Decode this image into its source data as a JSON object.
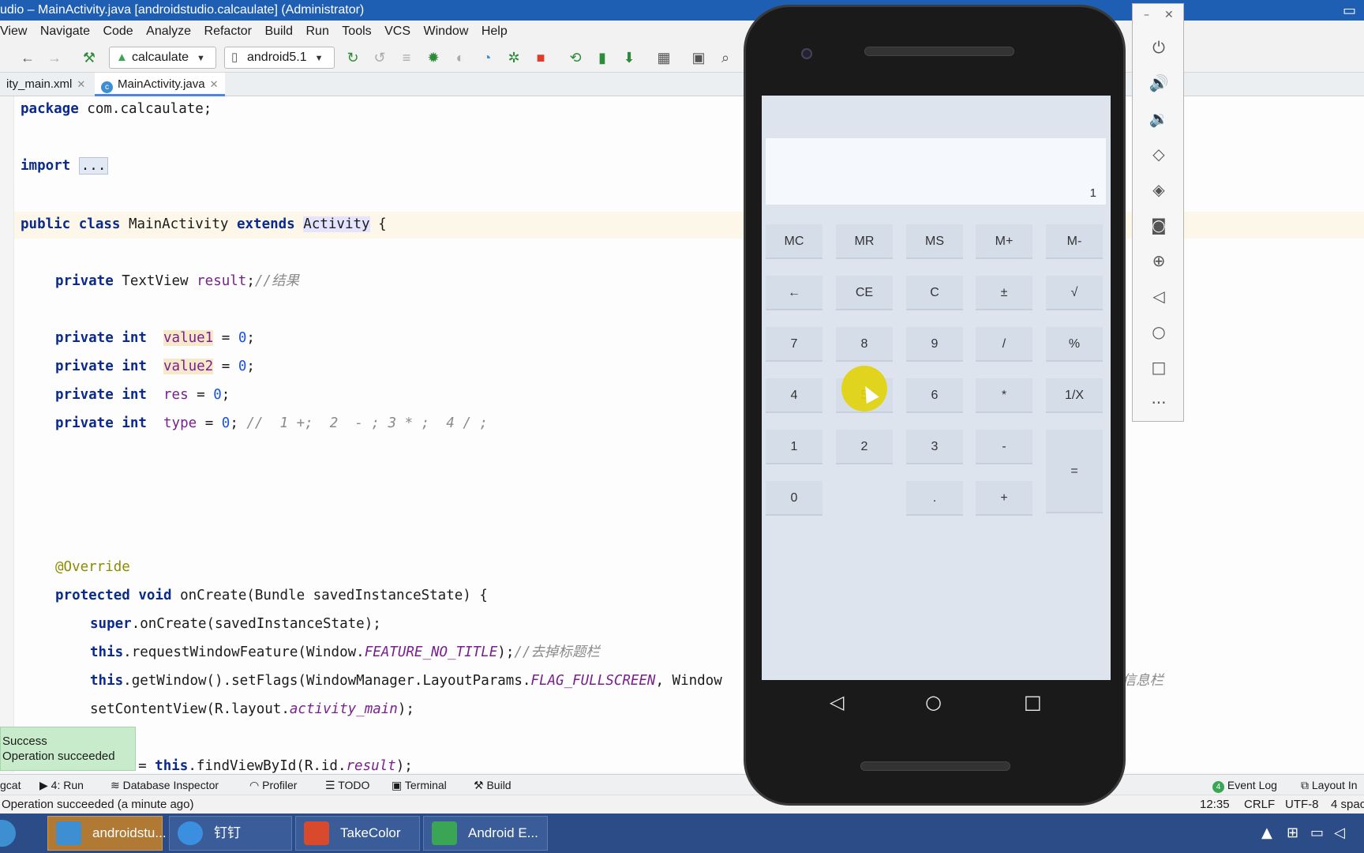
{
  "window": {
    "title": "udio – MainActivity.java [androidstudio.calcaulate] (Administrator)"
  },
  "menu": [
    "View",
    "Navigate",
    "Code",
    "Analyze",
    "Refactor",
    "Build",
    "Run",
    "Tools",
    "VCS",
    "Window",
    "Help"
  ],
  "toolbar": {
    "run_config": "calcaulate",
    "device": "android5.1"
  },
  "tabs": [
    {
      "label": "ity_main.xml"
    },
    {
      "label": "MainActivity.java"
    }
  ],
  "code": {
    "package_kw": "package",
    "package_name": " com.calcaulate;",
    "import_kw": "import",
    "import_fold": "...",
    "l3_public": "public",
    "l3_class": "class",
    "l3_name": " MainActivity ",
    "l3_extends": "extends",
    "l3_activity": "Activity",
    "l3_brace": " {",
    "l5_private": "private",
    "l5_type": " TextView ",
    "l5_field": "result",
    "l5_semi": ";",
    "l5_comment": "//结果",
    "l7_private": "private",
    "l7_int": "int",
    "l7_field": "value1",
    "l7_rest": " = ",
    "l7_num": "0",
    "l7_semi": ";",
    "l8_private": "private",
    "l8_int": "int",
    "l8_field": "value2",
    "l8_rest": " = ",
    "l8_num": "0",
    "l8_semi": ";",
    "l9_private": "private",
    "l9_int": "int",
    "l9_field": "res",
    "l9_rest": " = ",
    "l9_num": "0",
    "l9_semi": ";",
    "l10_private": "private",
    "l10_int": "int",
    "l10_field": "type",
    "l10_rest": " = ",
    "l10_num": "0",
    "l10_semi": ";",
    "l10_comment": " //  1 +;  2  - ; 3 * ;  4 / ;",
    "override": "@Override",
    "oc_protected": "protected",
    "oc_void": "void",
    "oc_sig": " onCreate(Bundle savedInstanceState) {",
    "sup_kw": "super",
    "sup_rest": ".onCreate(savedInstanceState);",
    "rw_this": "this",
    "rw_mid": ".requestWindowFeature(Window.",
    "rw_const": "FEATURE_NO_TITLE",
    "rw_end": ");",
    "rw_comment": "//去掉标题栏",
    "gw_this": "this",
    "gw_mid": ".getWindow().setFlags(WindowManager.LayoutParams.",
    "gw_const": "FLAG_FULLSCREEN",
    "gw_end": ", Window",
    "gw_tail_comment": "掉信息栏",
    "scv_start": "setContentView(R.layout.",
    "scv_const": "activity_main",
    "scv_end": ");",
    "fv_pre": "t = ",
    "fv_this": "this",
    "fv_mid": ".findViewById(R.id.",
    "fv_const": "result",
    "fv_end": ");"
  },
  "toast": {
    "title": "Success",
    "message": "Operation succeeded"
  },
  "bottom_tools": {
    "logcat": "gcat",
    "run": "4: Run",
    "db": "Database Inspector",
    "profiler": "Profiler",
    "todo": "TODO",
    "terminal": "Terminal",
    "build": "Build",
    "event_log": "Event Log",
    "event_count": "4",
    "layout": "Layout In"
  },
  "status": {
    "message": "Operation succeeded (a minute ago)",
    "position": "12:35",
    "line_sep": "CRLF",
    "encoding": "UTF-8",
    "indent": "4 spac"
  },
  "taskbar": [
    {
      "label": "androidstu...",
      "color": "#3d8fd1"
    },
    {
      "label": "钉钉",
      "color": "#3a8fe0"
    },
    {
      "label": "TakeColor",
      "color": "#d84a2b"
    },
    {
      "label": "Android E...",
      "color": "#3aa655"
    }
  ],
  "calculator": {
    "display": "1",
    "rows": [
      [
        "MC",
        "MR",
        "MS",
        "M+",
        "M-"
      ],
      [
        "←",
        "CE",
        "C",
        "±",
        "√"
      ],
      [
        "7",
        "8",
        "9",
        "/",
        "%"
      ],
      [
        "4",
        "5",
        "6",
        "*",
        "1/X"
      ],
      [
        "1",
        "2",
        "3",
        "-",
        "="
      ],
      [
        "0",
        ".",
        "+"
      ]
    ]
  },
  "phone_nav": {
    "back": "◁",
    "home": "○",
    "recents": "□"
  },
  "emulator_controls": [
    "power-icon",
    "volume-up-icon",
    "volume-down-icon",
    "rotate-left-icon",
    "rotate-right-icon",
    "camera-icon",
    "zoom-icon",
    "back-icon",
    "home-icon",
    "overview-icon",
    "more-icon"
  ]
}
